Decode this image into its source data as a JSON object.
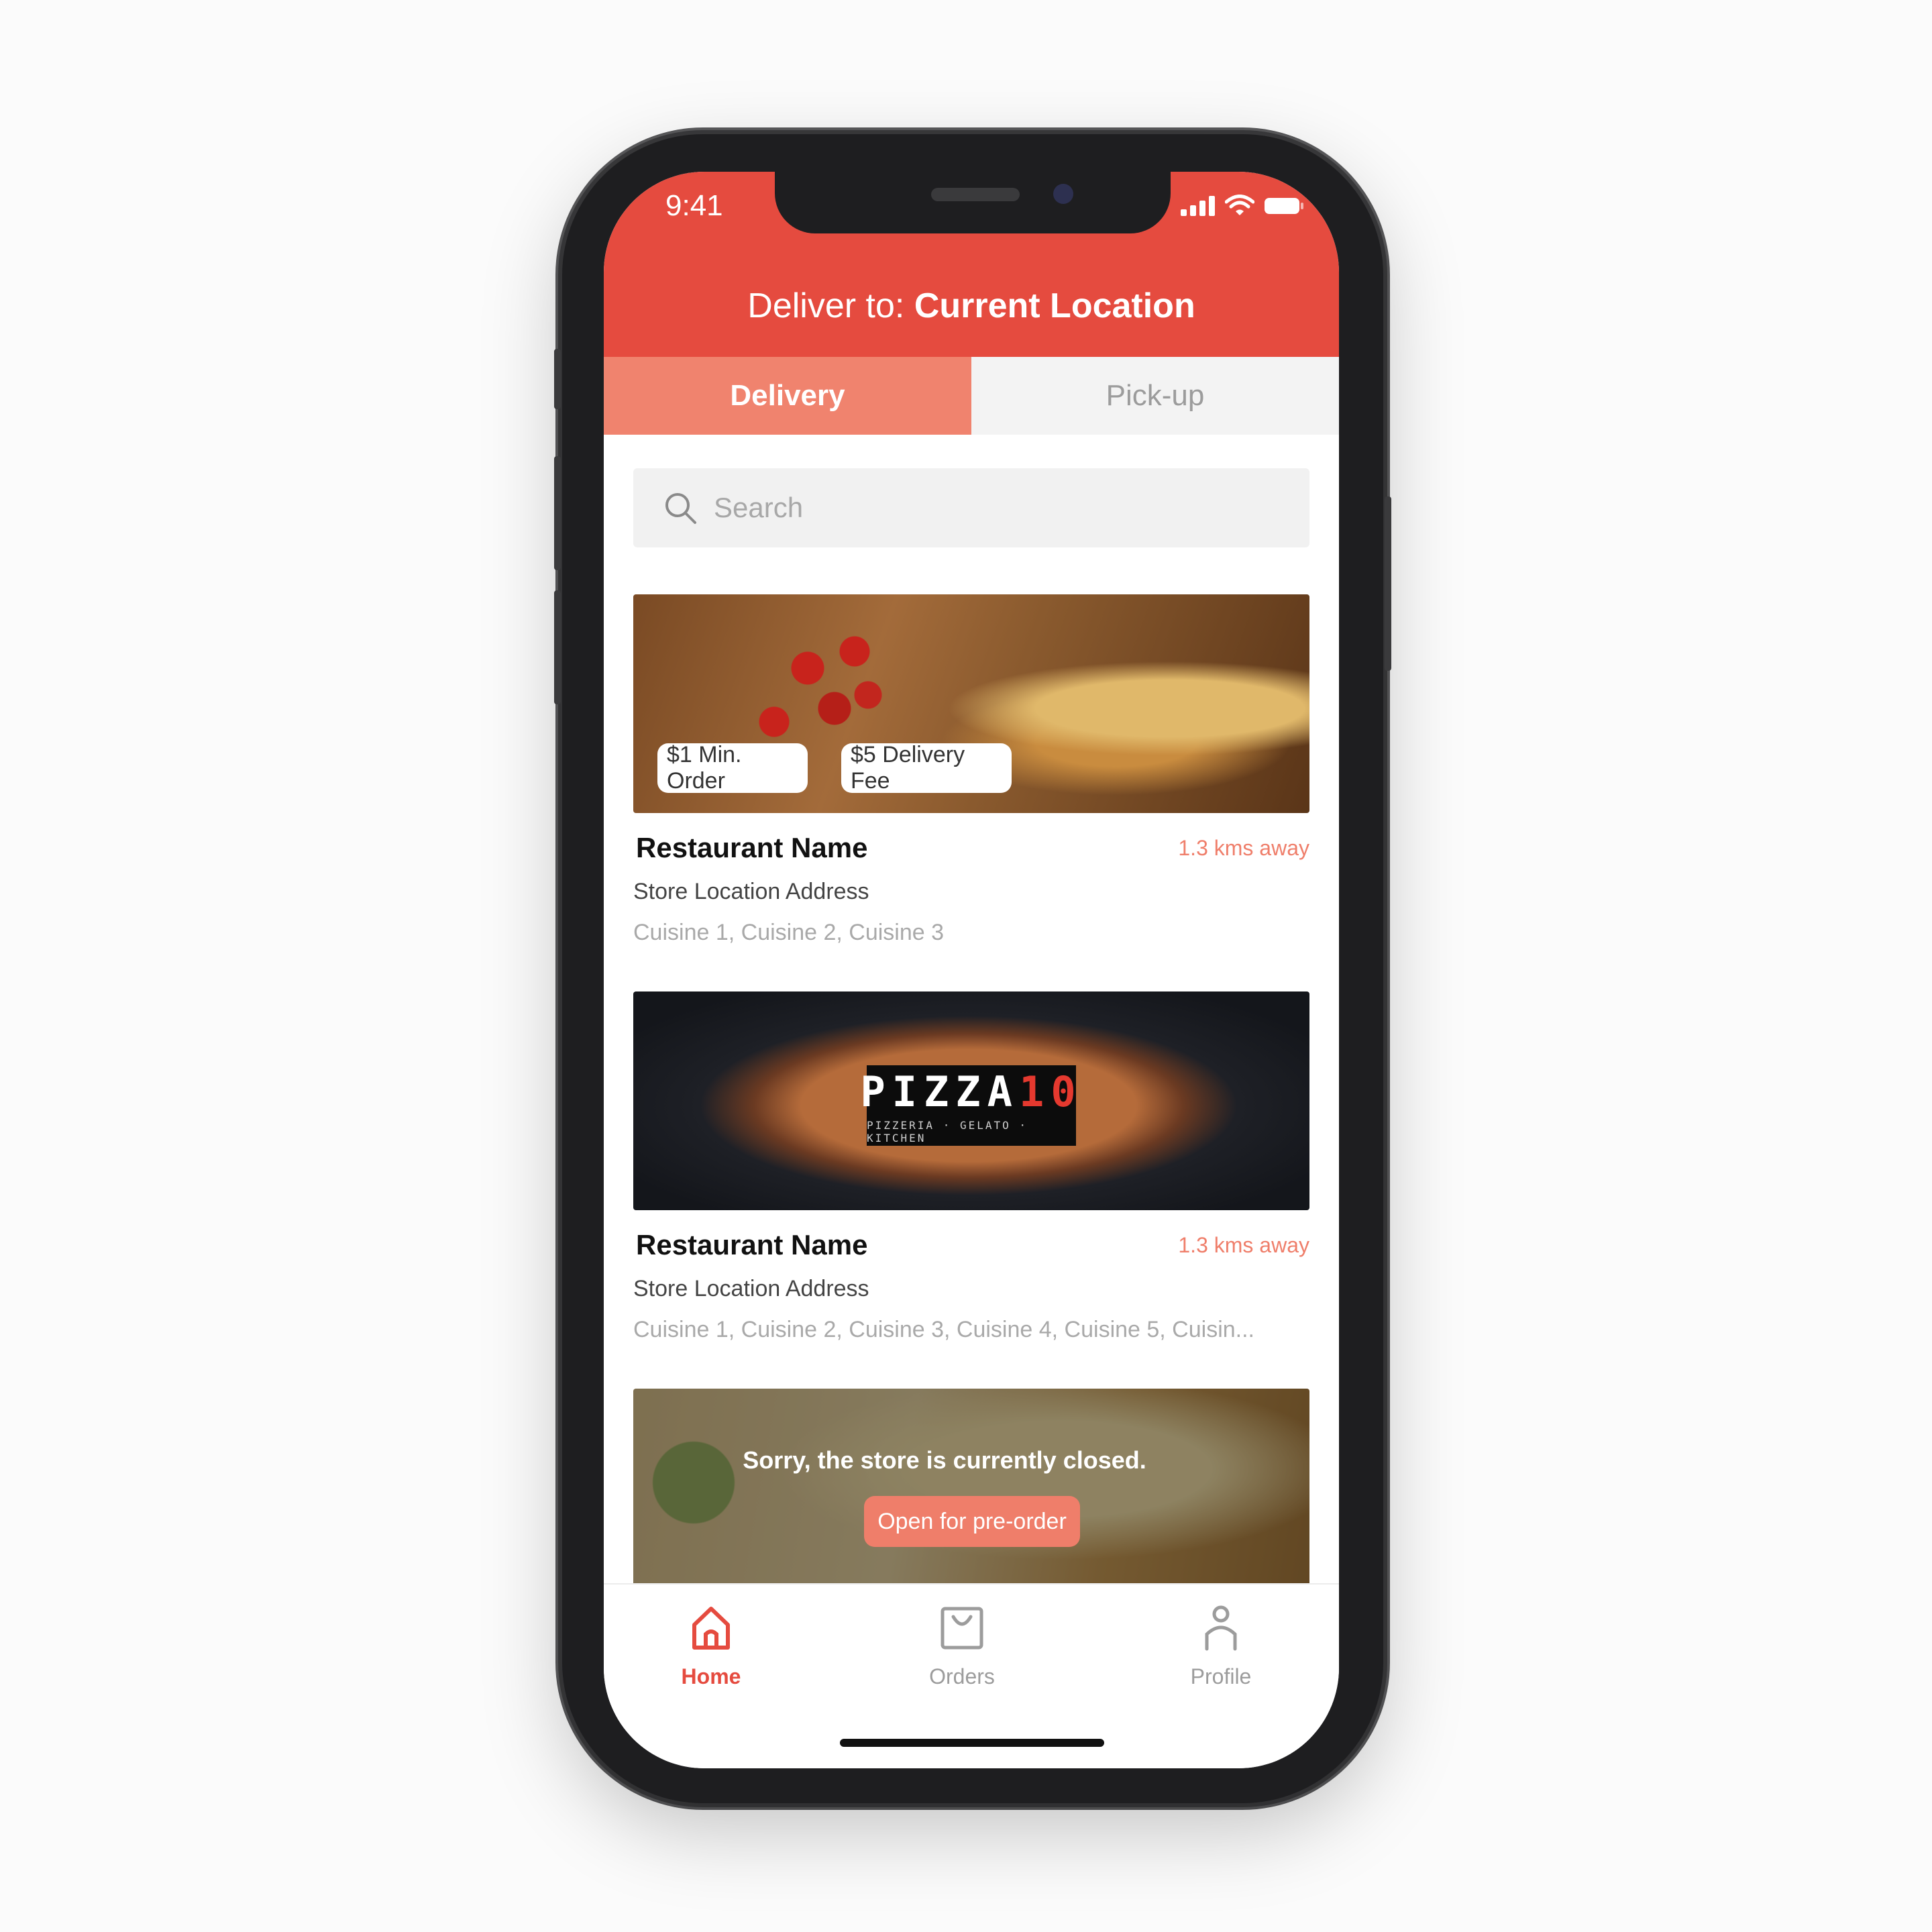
{
  "status": {
    "time": "9:41"
  },
  "header": {
    "prefix": "Deliver to: ",
    "location": "Current Location"
  },
  "tabs": [
    {
      "label": "Delivery",
      "active": true
    },
    {
      "label": "Pick-up",
      "active": false
    }
  ],
  "search": {
    "placeholder": "Search",
    "value": ""
  },
  "restaurants": [
    {
      "badges": [
        "$1 Min. Order",
        "$5 Delivery Fee"
      ],
      "name": "Restaurant Name",
      "distance": "1.3 kms away",
      "address": "Store Location Address",
      "cuisines": "Cuisine 1, Cuisine 2, Cuisine 3"
    },
    {
      "logo_main": "PIZZA",
      "logo_num": "10",
      "logo_sub": "PIZZERIA · GELATO · KITCHEN",
      "name": "Restaurant Name",
      "distance": "1.3 kms away",
      "address": "Store Location Address",
      "cuisines": "Cuisine 1, Cuisine 2, Cuisine 3, Cuisine 4, Cuisine 5, Cuisin..."
    },
    {
      "closed_message": "Sorry, the store is currently closed.",
      "preorder_label": "Open for pre-order"
    }
  ],
  "tabbar": [
    {
      "label": "Home",
      "icon": "home-icon",
      "active": true
    },
    {
      "label": "Orders",
      "icon": "bag-icon",
      "active": false
    },
    {
      "label": "Profile",
      "icon": "person-icon",
      "active": false
    }
  ],
  "colors": {
    "accent": "#e54b3f",
    "accent_light": "#f0836e",
    "inactive": "#9c9c9c"
  }
}
